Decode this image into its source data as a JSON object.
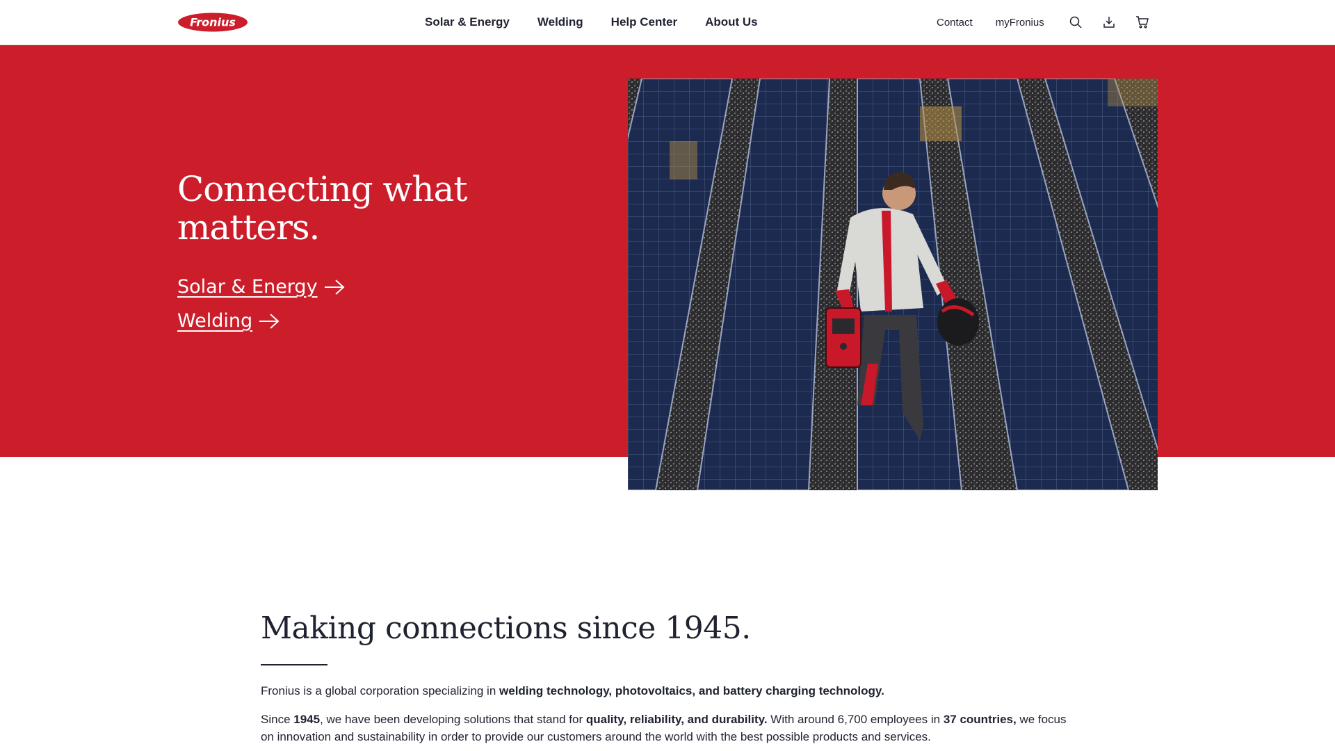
{
  "header": {
    "logo_text": "Fronius",
    "nav": [
      {
        "label": "Solar & Energy"
      },
      {
        "label": "Welding"
      },
      {
        "label": "Help Center"
      },
      {
        "label": "About Us"
      }
    ],
    "utility": {
      "contact": "Contact",
      "account": "myFronius"
    },
    "icons": [
      "search-icon",
      "download-icon",
      "cart-icon"
    ]
  },
  "hero": {
    "title": "Connecting what matters.",
    "links": [
      {
        "label": "Solar & Energy"
      },
      {
        "label": "Welding"
      }
    ],
    "background_color": "#cc1d2b"
  },
  "about": {
    "title": "Making connections since 1945.",
    "p1": {
      "a": "Fronius is a global corporation specializing in ",
      "b": "welding technology, photovoltaics, and battery charging technology."
    },
    "p2": {
      "a": "Since ",
      "b": "1945",
      "c": ", we have been developing solutions that stand for ",
      "d": "quality, reliability, and durability.",
      "e": " With around 6,700 employees in ",
      "f": "37 countries,",
      "g": " we focus on innovation and sustainability in order to provide our customers around the world with the best possible products and services."
    }
  },
  "colors": {
    "brand_red": "#cc1d2b",
    "text_dark": "#1f2230"
  }
}
